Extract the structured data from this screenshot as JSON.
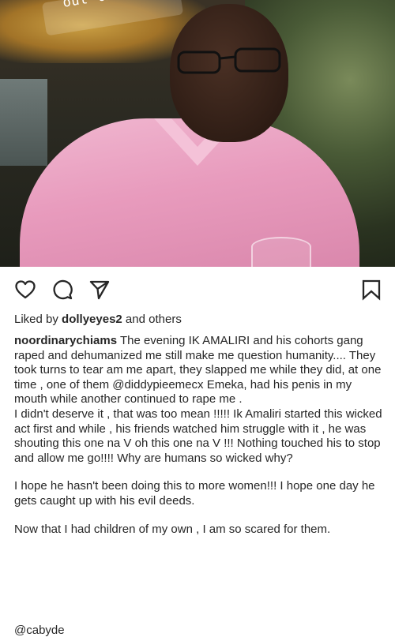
{
  "photo": {
    "overlay_text": "out there"
  },
  "actions": {
    "like_icon": "heart-icon",
    "comment_icon": "comment-icon",
    "share_icon": "paper-plane-icon",
    "save_icon": "bookmark-icon"
  },
  "likes": {
    "prefix": "Liked by ",
    "user": "dollyeyes2",
    "suffix": " and others"
  },
  "caption": {
    "username": "noordinarychiams",
    "line1_rest": " The evening IK AMALIRI and his cohorts gang raped and dehumanized me still make me question humanity.... They took turns to tear am me apart, they slapped me while they did, at one time , one of them ",
    "mention": "@diddypieemecx",
    "line1_end": " Emeka, had his penis in my mouth while another continued to rape me .",
    "para2": "I didn't deserve it , that was too mean !!!!! Ik Amaliri started this wicked act first and while , his friends watched him struggle with it , he was shouting this one na V oh this one na V !!! Nothing touched his to stop and allow me go!!!! Why are humans so wicked why?",
    "para3": "I hope he hasn't been doing this to more women!!! I hope one day he gets caught up with his evil deeds.",
    "para4": "Now that I had children of my own , I am so scared for them."
  },
  "bottom_mention": "@cabyde"
}
